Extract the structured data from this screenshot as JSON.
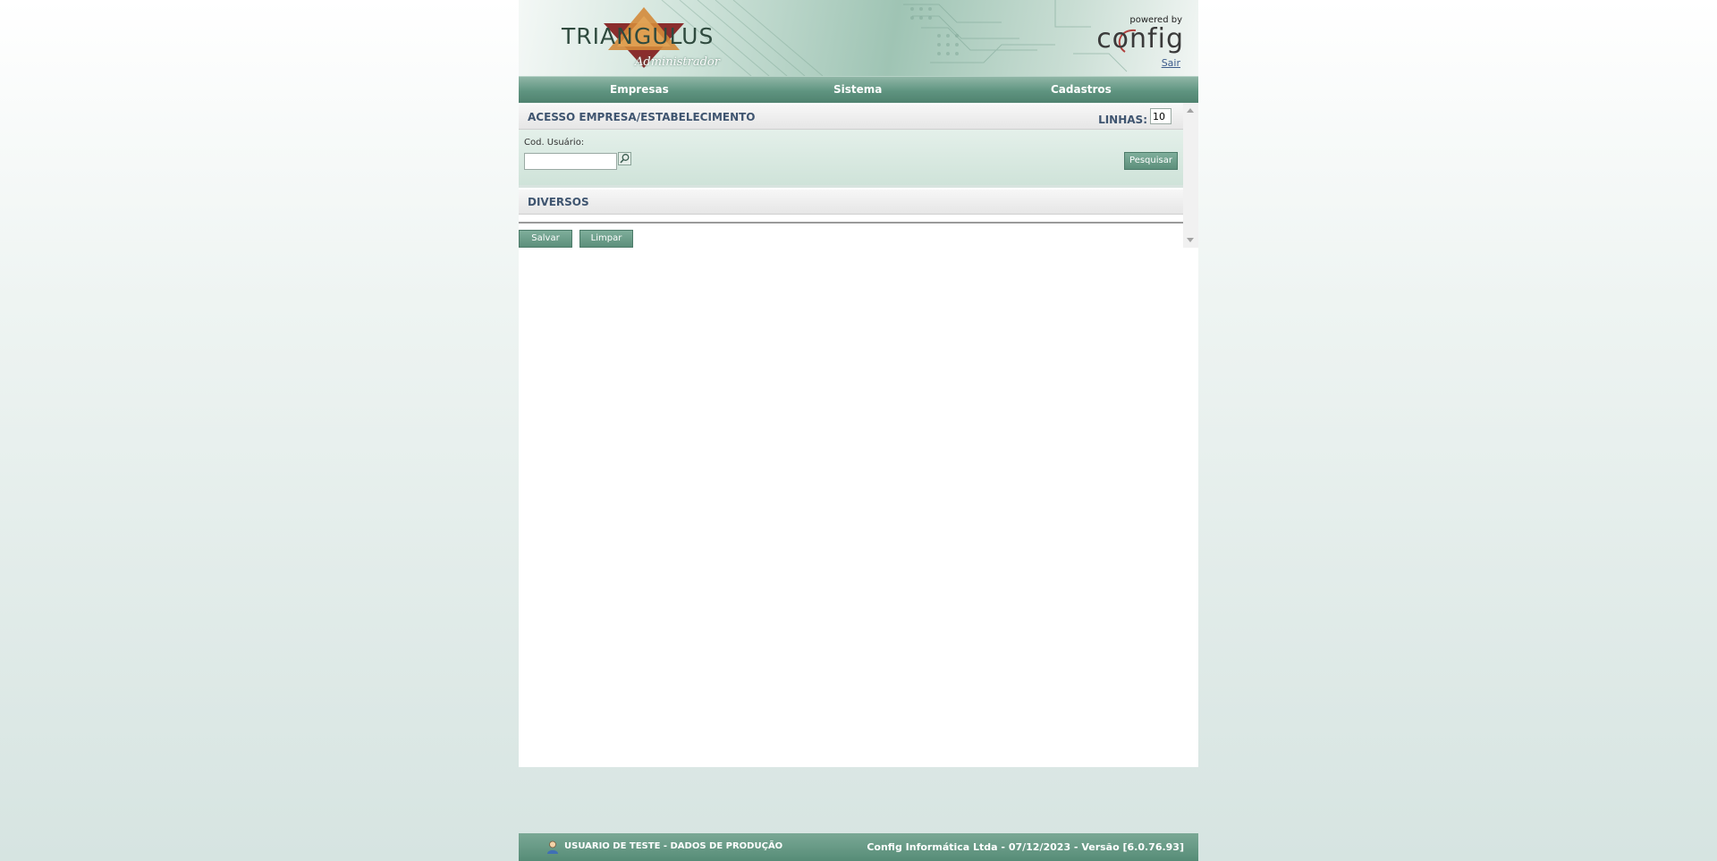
{
  "header": {
    "logo_text": "TRIANGULUS",
    "logo_subtitle": "Administrador",
    "powered_by": "powered by",
    "brand": "config",
    "logout_label": "Sair"
  },
  "nav": {
    "items": [
      {
        "label": "Empresas"
      },
      {
        "label": "Sistema"
      },
      {
        "label": "Cadastros"
      }
    ]
  },
  "section_access": {
    "title": "ACESSO EMPRESA/ESTABELECIMENTO",
    "rows_label": "LINHAS:",
    "rows_value": "10"
  },
  "filter": {
    "user_code_label": "Cod. Usuário:",
    "user_code_value": "",
    "search_button": "Pesquisar"
  },
  "section_misc": {
    "title": "DIVERSOS"
  },
  "actions": {
    "save_label": "Salvar",
    "clear_label": "Limpar"
  },
  "footer": {
    "user_text": "USUARIO DE TESTE - DADOS DE PRODUÇÃO",
    "version_text": "Config Informática Ltda - 07/12/2023 - Versão [6.0.76.93]"
  },
  "colors": {
    "accent": "#5c8f7b",
    "title_text": "#3f5570"
  }
}
